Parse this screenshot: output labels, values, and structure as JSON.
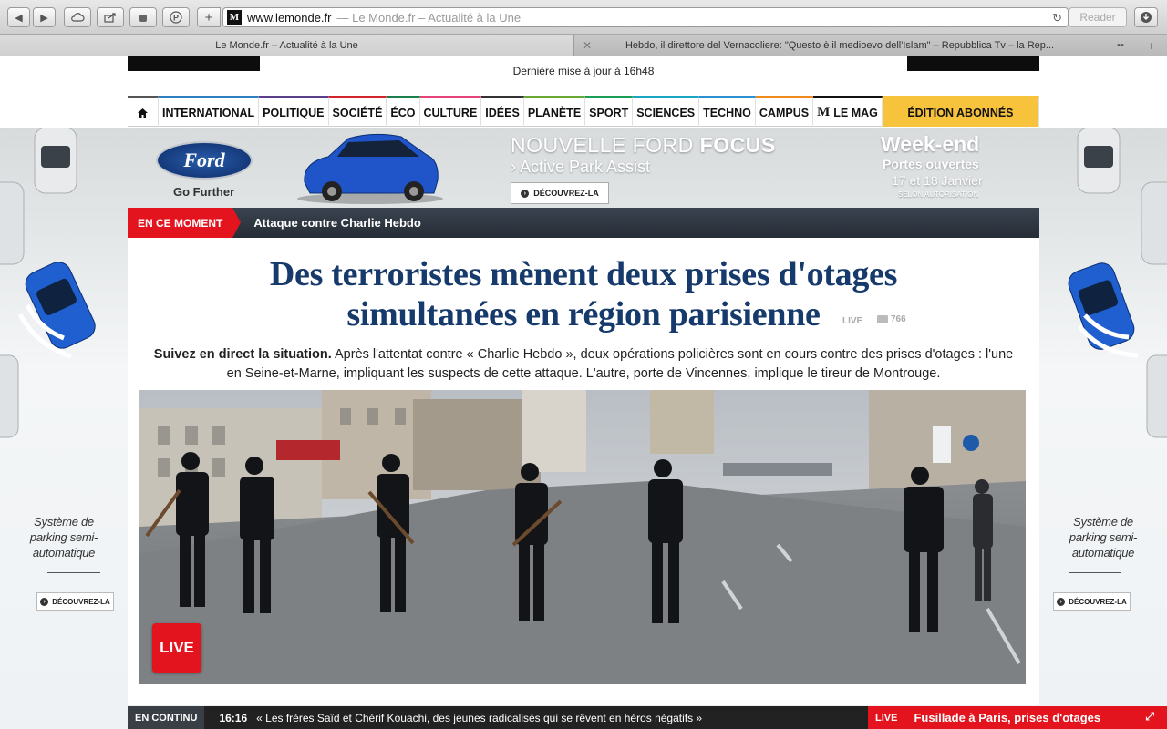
{
  "browser": {
    "address": {
      "url": "www.lemonde.fr",
      "title_suffix": "— Le Monde.fr – Actualité à la Une",
      "site_icon": "M"
    },
    "reader_label": "Reader",
    "tabs": [
      {
        "label": "Le Monde.fr – Actualité à la Une",
        "active": true
      },
      {
        "label": "Hebdo, il direttore del Vernacoliere: \"Questo è il medioevo dell'Islam\" – Repubblica Tv – la Rep...",
        "active": false
      }
    ]
  },
  "header": {
    "update": "Dernière mise à jour à 16h48"
  },
  "nav": {
    "items": [
      {
        "label": "INTERNATIONAL",
        "color": "#2e7fbf"
      },
      {
        "label": "POLITIQUE",
        "color": "#5b3f8a"
      },
      {
        "label": "SOCIÉTÉ",
        "color": "#d2232a"
      },
      {
        "label": "ÉCO",
        "color": "#1a7f4b"
      },
      {
        "label": "CULTURE",
        "color": "#e6437b"
      },
      {
        "label": "IDÉES",
        "color": "#333333"
      },
      {
        "label": "PLANÈTE",
        "color": "#6aa834"
      },
      {
        "label": "SPORT",
        "color": "#1b9e57"
      },
      {
        "label": "SCIENCES",
        "color": "#1aa5c2"
      },
      {
        "label": "TECHNO",
        "color": "#2b8fd0"
      },
      {
        "label": "CAMPUS",
        "color": "#f08a1c"
      }
    ],
    "mag_logo": "M",
    "mag_label": "LE MAG",
    "abonnes": "ÉDITION ABONNÉS"
  },
  "ad": {
    "brand": "Ford",
    "tagline": "Go Further",
    "title_light": "NOUVELLE FORD",
    "title_bold": "FOCUS",
    "subtitle": "› Active Park Assist",
    "cta": "DÉCOUVREZ-LA",
    "weekend_title": "Week-end",
    "weekend_sub": "Portes ouvertes",
    "weekend_dates": "17 et 18 Janvier",
    "weekend_note": "SELON AUTORISATION",
    "side_text_1": "Système de",
    "side_text_2": "parking semi-",
    "side_text_3": "automatique",
    "side_cta": "DÉCOUVREZ-LA",
    "cta_icon": "›"
  },
  "moment": {
    "label": "EN CE MOMENT",
    "text": "Attaque contre Charlie Hebdo"
  },
  "article": {
    "headline_1": "Des terroristes mènent deux prises d'otages",
    "headline_2": "simultanées en région parisienne",
    "live_tag": "LIVE",
    "comments": "766",
    "chapo_lead": "Suivez en direct la situation.",
    "chapo_body": " Après l'attentat contre « Charlie Hebdo », deux opérations policières sont en cours contre des prises d'otages : l'une en Seine-et-Marne, impliquant les suspects de cette attaque. L'autre, porte de Vincennes, implique le tireur de Montrouge.",
    "live_badge": "LIVE"
  },
  "ticker": {
    "label": "EN CONTINU",
    "time": "16:16",
    "text": "« Les frères Saïd et Chérif Kouachi, des jeunes radicalisés qui se rêvent en héros négatifs »"
  },
  "live_bar": {
    "label": "LIVE",
    "text": "Fusillade à Paris, prises d'otages",
    "expand_icon": "⤢"
  }
}
